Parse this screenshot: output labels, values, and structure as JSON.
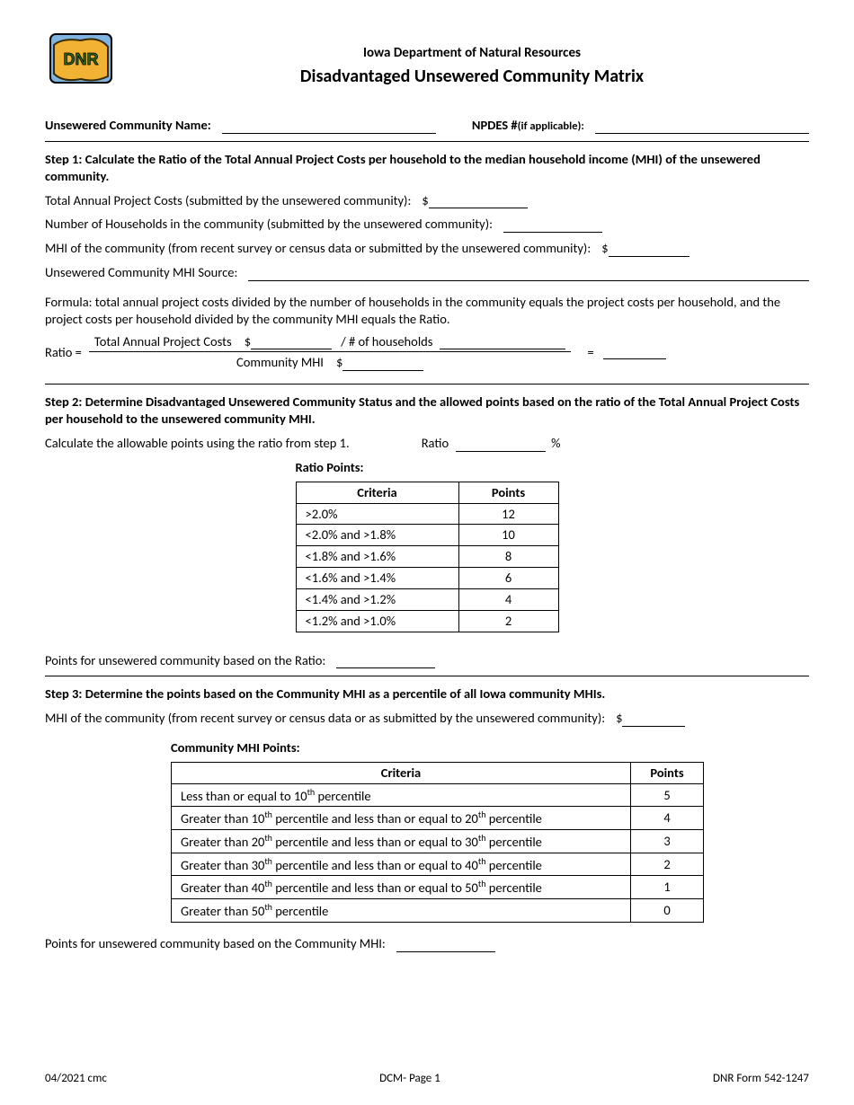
{
  "header": {
    "dept": "Iowa Department of Natural Resources",
    "title": "Disadvantaged Unsewered Community Matrix"
  },
  "top_fields": {
    "community_label": "Unsewered Community Name:",
    "npdes_label": "NPDES # ",
    "npdes_note": "(if applicable):"
  },
  "step1": {
    "heading": "Step 1: Calculate the Ratio of the Total Annual Project Costs per household to the median household income (MHI) of the unsewered community.",
    "line1": "Total Annual Project Costs (submitted by the unsewered community):",
    "line2": "Number of Households in the community (submitted by the unsewered community):",
    "line3": "MHI of the community (from recent survey or census data or submitted by the unsewered community):",
    "line4": "Unsewered Community MHI Source:",
    "formula_text": "Formula: total annual project costs divided by the number of households in the community equals the project costs per household, and the project costs per household divided by the community MHI equals the Ratio.",
    "ratio_label": "Ratio =",
    "frac_top_a": "Total Annual Project Costs",
    "frac_top_b": "/ # of households",
    "frac_bot": "Community MHI",
    "dollar": "$",
    "equals": "="
  },
  "step2": {
    "heading": "Step 2: Determine Disadvantaged Unsewered Community Status and the allowed points based on the ratio of the Total Annual Project Costs per household to the unsewered community MHI.",
    "calc_line": "Calculate the allowable points using the ratio from step 1.",
    "ratio_label": "Ratio",
    "percent": "%",
    "table_caption": "Ratio Points:",
    "table_headers": [
      "Criteria",
      "Points"
    ],
    "rows": [
      {
        "criteria": ">2.0%",
        "points": "12"
      },
      {
        "criteria": "<2.0% and >1.8%",
        "points": "10"
      },
      {
        "criteria": "<1.8% and >1.6%",
        "points": "8"
      },
      {
        "criteria": "<1.6% and >1.4%",
        "points": "6"
      },
      {
        "criteria": "<1.4% and >1.2%",
        "points": "4"
      },
      {
        "criteria": "<1.2% and >1.0%",
        "points": "2"
      }
    ],
    "points_line": "Points for unsewered community based on the Ratio:"
  },
  "step3": {
    "heading": "Step 3: Determine the points based on the Community MHI as a percentile of all Iowa community MHIs.",
    "mhi_line": "MHI of the community (from recent survey or census data or as submitted by the unsewered community):",
    "table_caption": "Community MHI Points:",
    "table_headers": [
      "Criteria",
      "Points"
    ],
    "rows": [
      {
        "criteria_html": "Less than or equal to 10<sup>th</sup> percentile",
        "points": "5"
      },
      {
        "criteria_html": "Greater than 10<sup>th</sup> percentile and less than or equal to 20<sup>th</sup> percentile",
        "points": "4"
      },
      {
        "criteria_html": "Greater than 20<sup>th</sup> percentile and less than or equal to 30<sup>th</sup> percentile",
        "points": "3"
      },
      {
        "criteria_html": "Greater than 30<sup>th</sup> percentile and less than or equal to 40<sup>th</sup> percentile",
        "points": "2"
      },
      {
        "criteria_html": "Greater than 40<sup>th</sup> percentile and less than or equal to 50<sup>th</sup> percentile",
        "points": "1"
      },
      {
        "criteria_html": "Greater than 50<sup>th</sup> percentile",
        "points": "0"
      }
    ],
    "points_line": "Points for unsewered community based on the Community MHI:"
  },
  "footer": {
    "left": "04/2021 cmc",
    "center": "DCM- Page 1",
    "right": "DNR Form 542-1247"
  }
}
